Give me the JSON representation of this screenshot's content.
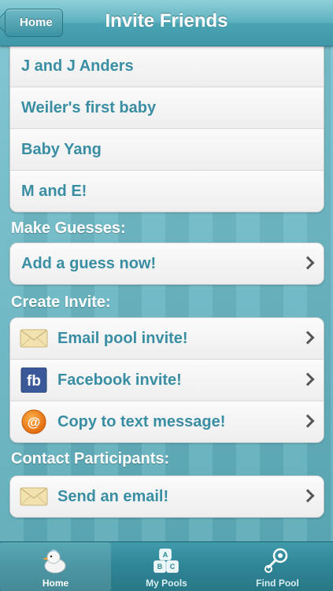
{
  "nav": {
    "title": "Invite Friends",
    "back_label": "Home"
  },
  "pools": [
    {
      "label": "J and J Anders"
    },
    {
      "label": "Weiler's first baby"
    },
    {
      "label": "Baby Yang"
    },
    {
      "label": "M and E!"
    }
  ],
  "make_guesses": {
    "title": "Make Guesses:",
    "add_guess_label": "Add a guess now!"
  },
  "create_invite": {
    "title": "Create Invite:",
    "items": [
      {
        "label": "Email pool invite!",
        "icon": "envelope-icon"
      },
      {
        "label": "Facebook invite!",
        "icon": "facebook-icon",
        "icon_text": "fb"
      },
      {
        "label": "Copy to text message!",
        "icon": "at-sign-icon",
        "icon_text": "@"
      }
    ]
  },
  "contact_participants": {
    "title": "Contact Participants:",
    "send_email_label": "Send an email!"
  },
  "tabs": [
    {
      "label": "Home",
      "icon": "baby-duck-icon",
      "active": true
    },
    {
      "label": "My Pools",
      "icon": "abc-blocks-icon",
      "active": false
    },
    {
      "label": "Find Pool",
      "icon": "rattle-icon",
      "active": false
    }
  ],
  "colors": {
    "accent_text": "#3a8ea3",
    "background": "#6ab6c3",
    "nav_bar": "#4aa3b2",
    "tab_bar": "#2f8595"
  }
}
